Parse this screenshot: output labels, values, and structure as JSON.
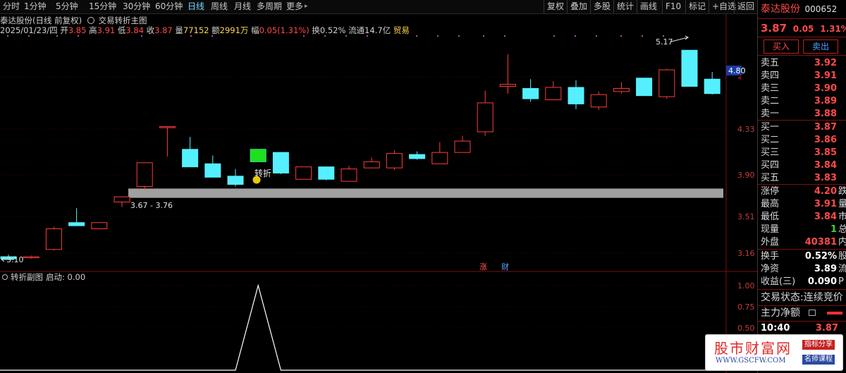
{
  "toolbar": {
    "periods": [
      "分时",
      "1分钟",
      "5分钟",
      "15分钟",
      "30分钟",
      "60分钟",
      "日线",
      "周线",
      "月线",
      "多周期",
      "更多"
    ],
    "selected_period": "日线",
    "more_arrow": "▸",
    "right_buttons": [
      "复权",
      "叠加",
      "多股",
      "统计",
      "画线",
      "F10",
      "标记",
      "+自选",
      "返回"
    ]
  },
  "chart_header": {
    "title": "泰达股份(日线 前复权)",
    "indicator_icon": "circle-icon",
    "indicator_name": "交易转折主图",
    "date": "2025/01/23/四",
    "open_label": "开",
    "open": "3.85",
    "high_label": "高",
    "high": "3.91",
    "low_label": "低",
    "low": "3.84",
    "close_label": "收",
    "close": "3.87",
    "volume_label": "量",
    "volume": "77152",
    "amount_label": "额",
    "amount": "2991万",
    "range_label": "幅",
    "range": "0.05(1.31%)",
    "turnover": "换0.52%",
    "float_cap": "流通14.7亿",
    "industry": "贸易"
  },
  "price_axis": {
    "ticks": [
      "4.80",
      "4.33",
      "3.90",
      "3.51",
      "3.16"
    ],
    "current_price_tag": "4.80"
  },
  "annotations": {
    "zone_label": "3.67 - 3.76",
    "peak_label": "5.17",
    "low_label": "3.10",
    "turn_label": "转折",
    "event_tags": [
      "涨",
      "财"
    ]
  },
  "chart_data": {
    "type": "candlestick",
    "y_range": [
      2.95,
      5.45
    ],
    "candles": [
      {
        "o": 3.1,
        "h": 3.12,
        "l": 3.07,
        "c": 3.08
      },
      {
        "o": 3.1,
        "h": 3.11,
        "l": 3.08,
        "c": 3.1
      },
      {
        "o": 3.17,
        "h": 3.39,
        "l": 3.16,
        "c": 3.37
      },
      {
        "o": 3.43,
        "h": 3.57,
        "l": 3.4,
        "c": 3.4
      },
      {
        "o": 3.37,
        "h": 3.43,
        "l": 3.37,
        "c": 3.43
      },
      {
        "o": 3.63,
        "h": 3.67,
        "l": 3.58,
        "c": 3.68
      },
      {
        "o": 3.78,
        "h": 4.01,
        "l": 3.75,
        "c": 4.01
      },
      {
        "o": 4.36,
        "h": 4.36,
        "l": 4.07,
        "c": 4.36
      },
      {
        "o": 4.14,
        "h": 4.26,
        "l": 3.97,
        "c": 3.97
      },
      {
        "o": 4.0,
        "h": 4.08,
        "l": 3.87,
        "c": 3.87
      },
      {
        "o": 3.88,
        "h": 3.95,
        "l": 3.78,
        "c": 3.8
      },
      {
        "o": 4.14,
        "h": 4.14,
        "l": 4.02,
        "c": 4.02
      },
      {
        "o": 4.11,
        "h": 4.11,
        "l": 3.9,
        "c": 3.91
      },
      {
        "o": 3.85,
        "h": 3.97,
        "l": 3.85,
        "c": 3.97
      },
      {
        "o": 3.97,
        "h": 3.97,
        "l": 3.84,
        "c": 3.85
      },
      {
        "o": 3.83,
        "h": 3.98,
        "l": 3.83,
        "c": 3.95
      },
      {
        "o": 3.96,
        "h": 4.06,
        "l": 3.96,
        "c": 4.02
      },
      {
        "o": 3.96,
        "h": 4.13,
        "l": 3.94,
        "c": 4.1
      },
      {
        "o": 4.09,
        "h": 4.12,
        "l": 4.04,
        "c": 4.05
      },
      {
        "o": 4.0,
        "h": 4.21,
        "l": 4.0,
        "c": 4.11
      },
      {
        "o": 4.11,
        "h": 4.27,
        "l": 4.11,
        "c": 4.22
      },
      {
        "o": 4.31,
        "h": 4.71,
        "l": 4.27,
        "c": 4.59
      },
      {
        "o": 4.75,
        "h": 5.06,
        "l": 4.68,
        "c": 4.77
      },
      {
        "o": 4.73,
        "h": 4.82,
        "l": 4.6,
        "c": 4.63
      },
      {
        "o": 4.62,
        "h": 4.8,
        "l": 4.62,
        "c": 4.74
      },
      {
        "o": 4.74,
        "h": 4.81,
        "l": 4.53,
        "c": 4.58
      },
      {
        "o": 4.55,
        "h": 4.7,
        "l": 4.52,
        "c": 4.67
      },
      {
        "o": 4.7,
        "h": 4.79,
        "l": 4.68,
        "c": 4.73
      },
      {
        "o": 4.83,
        "h": 4.83,
        "l": 4.66,
        "c": 4.66
      },
      {
        "o": 4.65,
        "h": 4.92,
        "l": 4.63,
        "c": 4.91
      },
      {
        "o": 5.1,
        "h": 5.1,
        "l": 4.75,
        "c": 4.75
      },
      {
        "o": 4.82,
        "h": 4.89,
        "l": 4.67,
        "c": 4.68
      }
    ],
    "zone": [
      3.67,
      3.76
    ],
    "sub_indicator": {
      "name": "转折副图",
      "value_label": "启动: 0.00",
      "y_ticks": [
        "1.00",
        "0.75",
        "0.50"
      ],
      "y_range": [
        0.0,
        1.09
      ],
      "values": [
        0,
        0,
        0,
        0,
        0,
        0,
        0,
        0,
        0,
        0,
        0,
        1,
        0,
        0,
        0,
        0,
        0,
        0,
        0,
        0,
        0,
        0,
        0,
        0,
        0,
        0,
        0,
        0,
        0,
        0,
        0,
        0
      ]
    }
  },
  "right_panel": {
    "stock_name": "泰达股份",
    "stock_code": "000652",
    "price": "3.87",
    "change": "0.05",
    "change_pct": "1.31%",
    "buy_button": "买入",
    "sell_button": "卖出",
    "asks": [
      {
        "label": "卖五",
        "price": "3.92"
      },
      {
        "label": "卖四",
        "price": "3.91"
      },
      {
        "label": "卖三",
        "price": "3.90"
      },
      {
        "label": "卖二",
        "price": "3.89"
      },
      {
        "label": "卖一",
        "price": "3.88"
      }
    ],
    "bids": [
      {
        "label": "买一",
        "price": "3.87"
      },
      {
        "label": "买二",
        "price": "3.86"
      },
      {
        "label": "买三",
        "price": "3.85"
      },
      {
        "label": "买四",
        "price": "3.84"
      },
      {
        "label": "买五",
        "price": "3.83"
      }
    ],
    "stats": [
      {
        "label": "涨停",
        "value": "4.20",
        "ext": "跌"
      },
      {
        "label": "最高",
        "value": "3.91",
        "ext": "量"
      },
      {
        "label": "最低",
        "value": "3.84",
        "ext": "市"
      },
      {
        "label": "现量",
        "value": "1",
        "ext": "总"
      },
      {
        "label": "外盘",
        "value": "40381",
        "ext": "内"
      }
    ],
    "stats2": [
      {
        "label": "换手",
        "value": "0.52%",
        "ext": "股"
      },
      {
        "label": "净资",
        "value": "3.89",
        "ext": "流"
      },
      {
        "label": "收益(三)",
        "value": "0.090",
        "ext": "P"
      }
    ],
    "trade_status_label": "交易状态:",
    "trade_status": "连续竞价",
    "main_net_label": "主力净额",
    "tick_time": "10:40",
    "tick_price": "3.87"
  },
  "watermark": {
    "title": "股市财富网",
    "url": "WWW.GSCFW.COM",
    "tag1": "指标分享",
    "tag2": "名师课程"
  }
}
